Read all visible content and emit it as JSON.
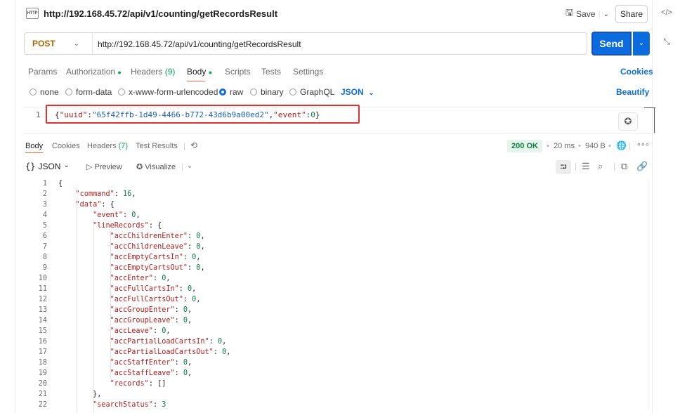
{
  "tab": {
    "badge": "HTTP",
    "title": "http://192.168.45.72/api/v1/counting/getRecordsResult"
  },
  "toolbar": {
    "save_label": "Save",
    "share_label": "Share"
  },
  "request": {
    "method": "POST",
    "url": "http://192.168.45.72/api/v1/counting/getRecordsResult",
    "send_label": "Send"
  },
  "request_tabs": {
    "params": "Params",
    "authorization": "Authorization",
    "headers": "Headers",
    "headers_count": "(9)",
    "body": "Body",
    "scripts": "Scripts",
    "tests": "Tests",
    "settings": "Settings",
    "cookies": "Cookies"
  },
  "body_types": {
    "none": "none",
    "form_data": "form-data",
    "urlencoded": "x-www-form-urlencoded",
    "raw": "raw",
    "binary": "binary",
    "graphql": "GraphQL",
    "selected_language": "JSON",
    "beautify": "Beautify"
  },
  "request_body": {
    "line_number": "1",
    "parts": {
      "open": "{",
      "key1": "\"uuid\"",
      "colon1": ":",
      "val1": "\"65f42ffb-1d49-4466-b772-43d6b9a00ed2\"",
      "comma": ",",
      "key2": "\"event\"",
      "colon2": ":",
      "val2": "0",
      "close": "}"
    }
  },
  "response_tabs": {
    "body": "Body",
    "cookies": "Cookies",
    "headers": "Headers",
    "headers_count": "(7)",
    "test_results": "Test Results"
  },
  "response_meta": {
    "status": "200 OK",
    "time": "20 ms",
    "size": "940 B"
  },
  "response_toolbar": {
    "format_braces": "{}",
    "format": "JSON",
    "preview": "Preview",
    "visualize": "Visualize"
  },
  "response_lines": [
    "{",
    "    \"command\": 16,",
    "    \"data\": {",
    "        \"event\": 0,",
    "        \"lineRecords\": {",
    "            \"accChildrenEnter\": 0,",
    "            \"accChildrenLeave\": 0,",
    "            \"accEmptyCartsIn\": 0,",
    "            \"accEmptyCartsOut\": 0,",
    "            \"accEnter\": 0,",
    "            \"accFullCartsIn\": 0,",
    "            \"accFullCartsOut\": 0,",
    "            \"accGroupEnter\": 0,",
    "            \"accGroupLeave\": 0,",
    "            \"accLeave\": 0,",
    "            \"accPartialLoadCartsIn\": 0,",
    "            \"accPartialLoadCartsOut\": 0,",
    "            \"accStaffEnter\": 0,",
    "            \"accStaffLeave\": 0,",
    "            \"records\": []",
    "        },",
    "        \"searchStatus\": 3"
  ],
  "icons": {
    "save": "save-icon",
    "chevron": "chevron-down-icon",
    "code": "code-icon",
    "history": "history-icon",
    "globe": "globe-icon",
    "wrap": "wrap-icon",
    "filter": "filter-icon",
    "search": "search-icon",
    "copy": "copy-icon",
    "link": "link-icon",
    "magic": "magic-wand-icon",
    "more": "more-icon"
  },
  "colors": {
    "accent": "#0a6cdf",
    "method": "#a86400",
    "status_ok": "#0a7f40",
    "highlight_box": "#e03131",
    "active_tab_underline": "#f26b3a"
  }
}
